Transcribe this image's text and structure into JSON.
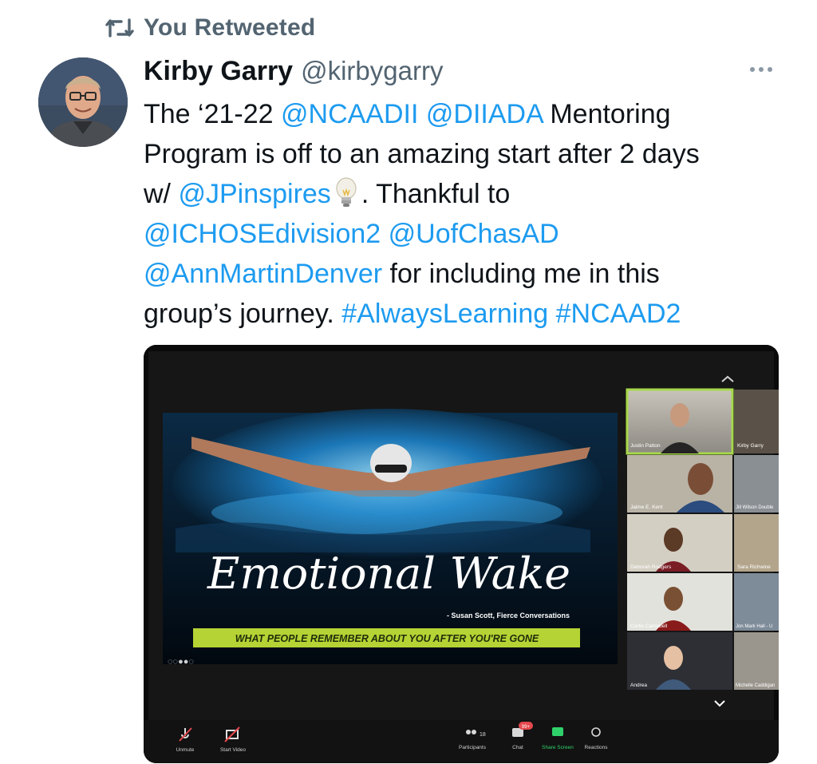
{
  "retweet": {
    "label": "You Retweeted"
  },
  "author": {
    "name": "Kirby Garry",
    "handle": "@kirbygarry"
  },
  "tweet": {
    "line1": {
      "pre": "The ‘21-22 ",
      "m1": "@NCAADII",
      "sp": " ",
      "m2": "@DIIADA",
      "post": " Mentoring"
    },
    "line2": "Program is off to an amazing start after 2 days",
    "line3": {
      "pre": "w/ ",
      "m1": "@JPinspires",
      "post": ". Thankful to"
    },
    "line4": {
      "m1": "@ICHOSEdivision2",
      "sp": " ",
      "m2": "@UofChasAD"
    },
    "line5": {
      "m1": "@AnnMartinDenver",
      "post": " for including me in this"
    },
    "line6": {
      "pre": "group’s journey. ",
      "h1": "#AlwaysLearning",
      "sp": " ",
      "h2": "#NCAAD2"
    }
  },
  "media": {
    "slide": {
      "title": "Emotional Wake",
      "attribution": "- Susan Scott, Fierce Conversations",
      "banner": "WHAT PEOPLE REMEMBER ABOUT YOU AFTER YOU'RE GONE"
    },
    "participants": [
      {
        "name": "Justin Patton"
      },
      {
        "name": "Kirby Garry"
      },
      {
        "name": "Jaime E. Kent"
      },
      {
        "name": "Jill Wilson Double"
      },
      {
        "name": "Deborah Rodgers"
      },
      {
        "name": "Sara Richwine"
      },
      {
        "name": "Curtis Campbell"
      },
      {
        "name": "Jon Mark Hall - U"
      },
      {
        "name": "Andrea"
      },
      {
        "name": "Michelle Caddigan"
      }
    ],
    "toolbar": {
      "unmute": "Unmute",
      "start_video": "Start Video",
      "participants": "Participants",
      "participants_count": "18",
      "chat": "Chat",
      "chat_badge": "99+",
      "share_screen": "Share Screen",
      "reactions": "Reactions"
    }
  },
  "colors": {
    "link": "#1d9bf0",
    "muted": "#536471",
    "banner": "#b5d334",
    "share_green": "#2fd16b",
    "active_speaker": "#a7d84a"
  }
}
